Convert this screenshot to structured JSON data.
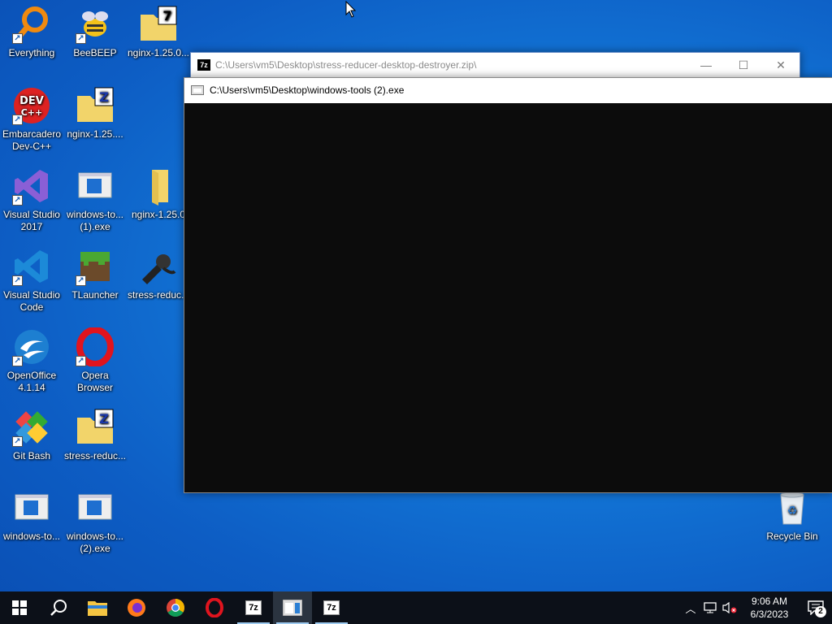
{
  "desktop": {
    "icons": [
      {
        "label": "Everything"
      },
      {
        "label": "BeeBEEP"
      },
      {
        "label": "nginx-1.25.0..."
      },
      {
        "label": "Embarcadero\nDev-C++"
      },
      {
        "label": "nginx-1.25...."
      },
      {
        "label": "Visual Studio\n2017"
      },
      {
        "label": "windows-to...\n(1).exe"
      },
      {
        "label": "nginx-1.25.0"
      },
      {
        "label": "Visual Studio\nCode"
      },
      {
        "label": "TLauncher"
      },
      {
        "label": "stress-reduc..."
      },
      {
        "label": "OpenOffice\n4.1.14"
      },
      {
        "label": "Opera\nBrowser"
      },
      {
        "label": "Git Bash"
      },
      {
        "label": "stress-reduc..."
      },
      {
        "label": "windows-to..."
      },
      {
        "label": "windows-to...\n(2).exe"
      },
      {
        "label": "Recycle Bin"
      }
    ]
  },
  "windows": {
    "archive": {
      "title": "C:\\Users\\vm5\\Desktop\\stress-reducer-desktop-destroyer.zip\\",
      "icon_text": "7z"
    },
    "console": {
      "title": "C:\\Users\\vm5\\Desktop\\windows-tools (2).exe"
    }
  },
  "taskbar": {
    "pinned": [
      "start-icon",
      "search-icon",
      "file-explorer-icon",
      "firefox-icon",
      "chrome-icon",
      "opera-icon",
      "7zip-icon",
      "console-app-icon",
      "7zip-icon"
    ],
    "clock_time": "9:06 AM",
    "clock_date": "6/3/2023",
    "notification_count": "2"
  },
  "colors": {
    "desktop": "#1379d9",
    "console_bg": "#0c0c0c",
    "taskbar": "#0c1018"
  }
}
